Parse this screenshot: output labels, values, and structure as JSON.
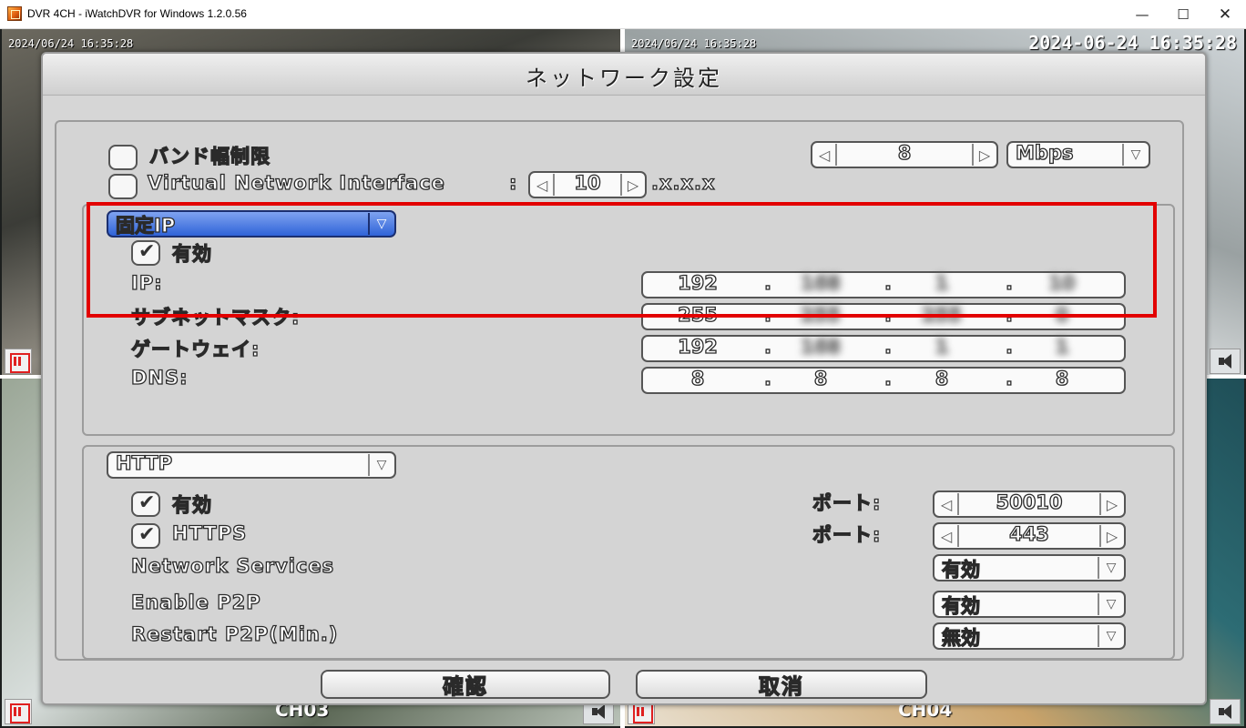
{
  "window": {
    "title": "DVR 4CH - iWatchDVR for Windows 1.2.0.56",
    "minimize": "—",
    "maximize": "☐",
    "close": "✕"
  },
  "cameras": {
    "ch1_timestamp": "2024/06/24 16:35:28",
    "ch2_timestamp": "2024/06/24 16:35:28",
    "clock": "2024-06-24 16:35:28",
    "ch3_label": "CH03",
    "ch4_label": "CH04"
  },
  "dialog": {
    "title": "ネットワーク設定",
    "bandwidth": {
      "label": "バンド幅制限",
      "value": "8",
      "unit": "Mbps"
    },
    "virtual_interface": {
      "label": "Virtual Network Interface",
      "colon": ":",
      "value": "10",
      "suffix": ".x.x.x"
    },
    "ip_section": {
      "mode": "固定IP",
      "enable_label": "有効",
      "ip_label": "IP:",
      "subnet_label": "サブネットマスク:",
      "gateway_label": "ゲートウェイ:",
      "dns_label": "DNS:",
      "ip": [
        "192",
        "168",
        "1",
        "10"
      ],
      "subnet": [
        "255",
        "255",
        "255",
        "0"
      ],
      "gateway": [
        "192",
        "168",
        "1",
        "1"
      ],
      "dns": [
        "8",
        "8",
        "8",
        "8"
      ],
      "dot": "."
    },
    "http_section": {
      "protocol": "HTTP",
      "enable_label": "有効",
      "https_label": "HTTPS",
      "port_label": "ポート:",
      "http_port": "50010",
      "https_port": "443",
      "network_services_label": "Network Services",
      "network_services_value": "有効",
      "p2p_label": "Enable P2P",
      "p2p_value": "有効",
      "restart_label": "Restart P2P(Min.)",
      "restart_value": "無効"
    },
    "ok_button": "確認",
    "cancel_button": "取消"
  },
  "colors": {
    "highlight": "#e20000",
    "selected_dropdown": "#2f63d8"
  }
}
